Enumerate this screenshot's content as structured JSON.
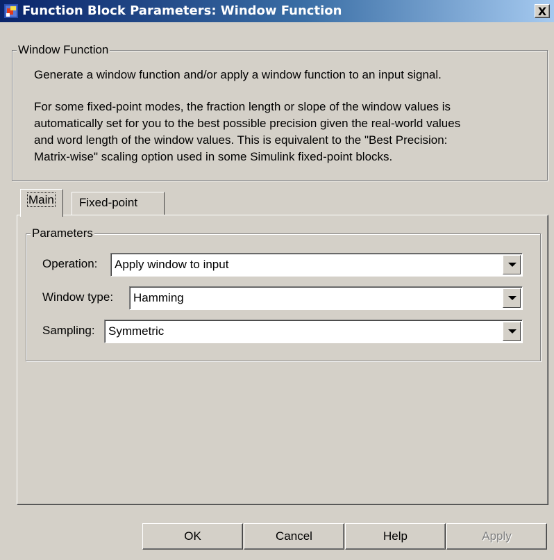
{
  "window": {
    "title": "Function Block Parameters: Window Function",
    "close_label": "X"
  },
  "description": {
    "group_title": "Window Function",
    "line1": "Generate a window function and/or apply a window function to an input signal.",
    "para2_line1": "For some fixed-point modes, the fraction length or slope of the window values is",
    "para2_line2": "automatically set for you to the best possible precision given the real-world values",
    "para2_line3": "and word length of the window values. This is equivalent to the \"Best Precision:",
    "para2_line4": "Matrix-wise\" scaling option used in some Simulink fixed-point blocks."
  },
  "tabs": [
    {
      "label": "Main",
      "active": true
    },
    {
      "label": "Fixed-point",
      "active": false
    }
  ],
  "parameters": {
    "group_title": "Parameters",
    "operation": {
      "label": "Operation:",
      "value": "Apply window to input"
    },
    "window_type": {
      "label": "Window type:",
      "value": "Hamming"
    },
    "sampling": {
      "label": "Sampling:",
      "value": "Symmetric"
    }
  },
  "buttons": {
    "ok": "OK",
    "cancel": "Cancel",
    "help": "Help",
    "apply": "Apply"
  }
}
